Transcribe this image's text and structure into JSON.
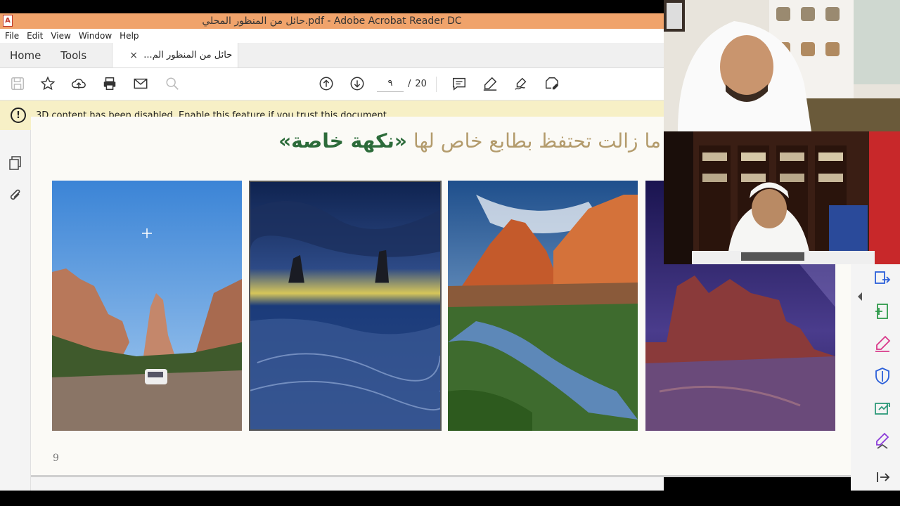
{
  "window": {
    "title": "حائل من المنظور المحلي.pdf - Adobe Acrobat Reader DC",
    "app_icon": "pdf-icon"
  },
  "menu": [
    "File",
    "Edit",
    "View",
    "Window",
    "Help"
  ],
  "tabs": {
    "home": "Home",
    "tools": "Tools",
    "document": "حائل من المنظور الم...",
    "close": "×"
  },
  "toolbar": {
    "icons": [
      "save-icon",
      "bookmark-star-icon",
      "upload-cloud-icon",
      "print-icon",
      "email-icon",
      "zoom-search-icon",
      "page-up-icon",
      "page-down-icon",
      "comment-icon",
      "highlight-pen-icon",
      "sign-icon",
      "edit-pdf-icon"
    ],
    "current_page": "٩",
    "separator": "/",
    "total_pages": "20"
  },
  "notice": {
    "icon": "!",
    "text": "3D content has been disabled. Enable this feature if you trust this document."
  },
  "left_panel": [
    "pages-thumbnail-icon",
    "attachment-paperclip-icon"
  ],
  "document": {
    "heading_plain": "ما زالت تحتفظ بطابع خاص لها",
    "heading_strong": "«نكهة خاصة»",
    "page_number": "9",
    "photos": [
      "desert-canyon-with-car",
      "night-sea-rocks",
      "rock-pool-sunset",
      "starry-night-rocks"
    ]
  },
  "right_panel": [
    "export-pdf-icon",
    "create-pdf-icon",
    "edit-pen-icon",
    "protect-shield-icon",
    "send-for-review-icon",
    "fill-sign-icon",
    "collapse-arrow-icon"
  ],
  "colors": {
    "title_bar": "#f0a36b",
    "notice_bg": "#f7f0c6",
    "heading_tan": "#b39b6c",
    "heading_green": "#2c6b3a",
    "tool_accent": "#2b5fd9"
  }
}
